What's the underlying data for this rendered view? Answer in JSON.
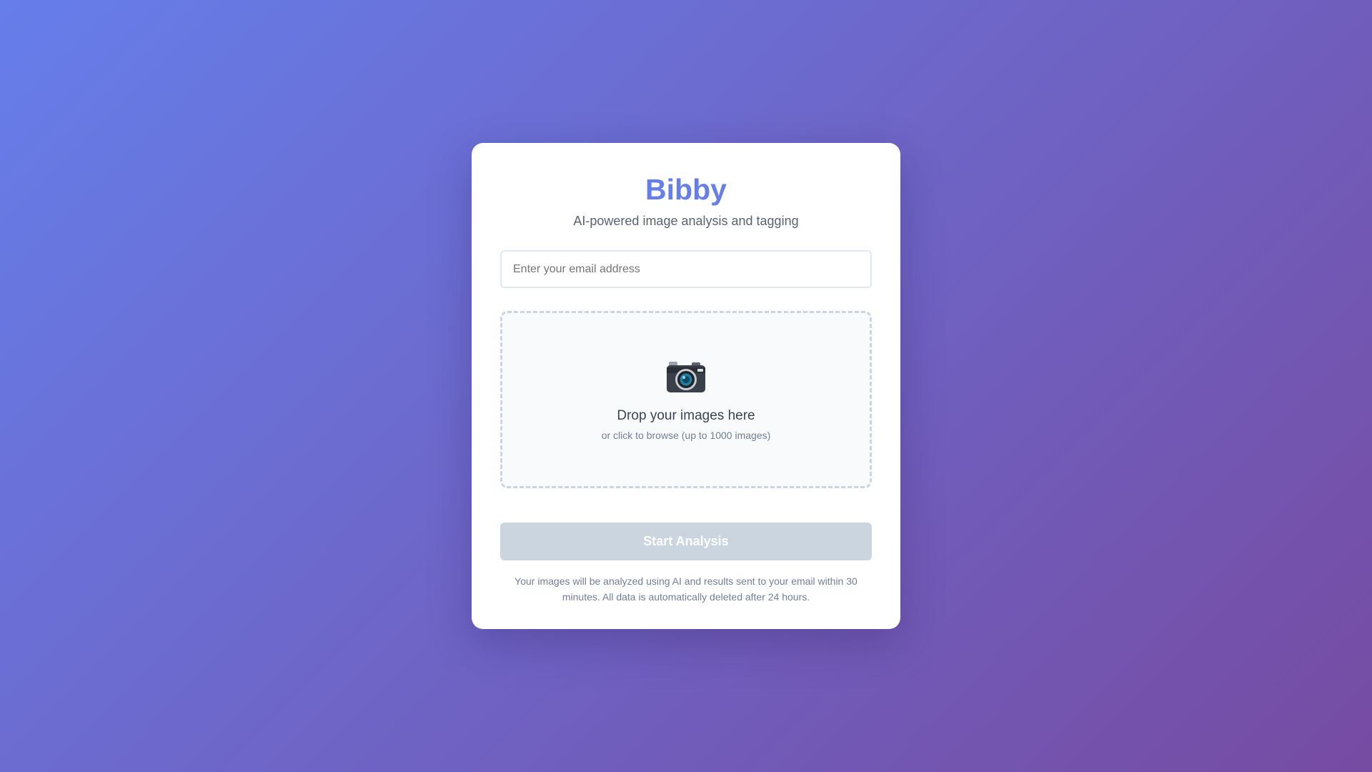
{
  "app": {
    "name": "Bibby",
    "tagline": "AI-powered image analysis and tagging",
    "brand_color": "#667eea"
  },
  "form": {
    "email_placeholder": "Enter your email address",
    "email_value": ""
  },
  "dropzone": {
    "icon": "camera-icon",
    "title": "Drop your images here",
    "subtitle": "or click to browse (up to 1000 images)"
  },
  "actions": {
    "start_label": "Start Analysis",
    "start_disabled": true
  },
  "footer": {
    "disclaimer": "Your images will be analyzed using AI and results sent to your email within 30 minutes. All data is automatically deleted after 24 hours."
  },
  "colors": {
    "background_gradient_start": "#667eea",
    "background_gradient_end": "#764ba2",
    "button_disabled": "#cbd5e0"
  }
}
